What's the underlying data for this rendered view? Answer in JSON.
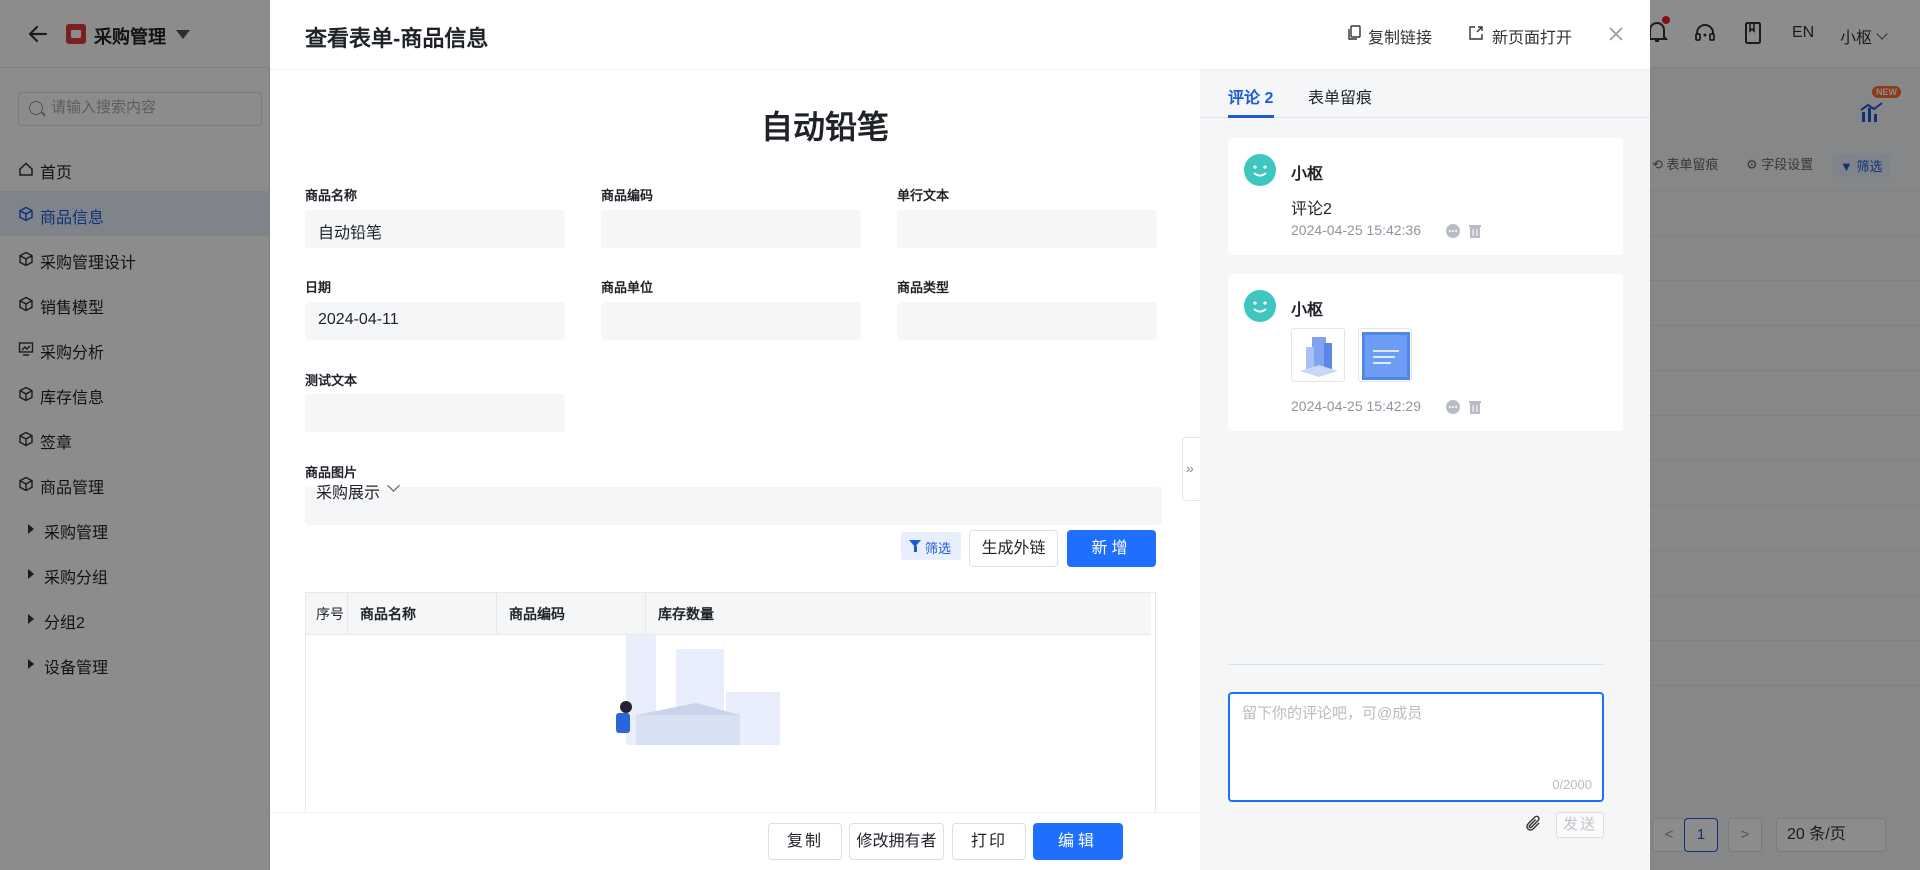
{
  "app": {
    "name": "采购管理",
    "lang": "EN",
    "user": "小枢",
    "search_placeholder": "请输入搜索内容"
  },
  "sidebar": {
    "items": [
      {
        "label": "首页",
        "icon": "home-icon"
      },
      {
        "label": "商品信息",
        "icon": "cube-icon",
        "active": true
      },
      {
        "label": "采购管理设计",
        "icon": "cube-icon"
      },
      {
        "label": "销售模型",
        "icon": "cube-icon"
      },
      {
        "label": "采购分析",
        "icon": "chart-icon"
      },
      {
        "label": "库存信息",
        "icon": "cube-icon"
      },
      {
        "label": "签章",
        "icon": "cube-icon"
      },
      {
        "label": "商品管理",
        "icon": "cube-icon"
      }
    ],
    "groups": [
      "采购管理",
      "采购分组",
      "分组2",
      "设备管理"
    ]
  },
  "background": {
    "toolbar": {
      "trace": "表单留痕",
      "field_settings": "字段设置",
      "filter": "筛选"
    },
    "new_badge": "NEW",
    "pager": {
      "current": "1",
      "page_size": "20 条/页",
      "prev": "<",
      "next": ">"
    }
  },
  "modal": {
    "title": "查看表单-商品信息",
    "copy_link": "复制链接",
    "open_new_page": "新页面打开",
    "form_title": "自动铅笔",
    "fields": {
      "name": {
        "label": "商品名称",
        "value": "自动铅笔"
      },
      "code": {
        "label": "商品编码",
        "value": ""
      },
      "single_text": {
        "label": "单行文本",
        "value": ""
      },
      "date": {
        "label": "日期",
        "value": "2024-04-11"
      },
      "unit": {
        "label": "商品单位",
        "value": ""
      },
      "type": {
        "label": "商品类型",
        "value": ""
      },
      "test_text": {
        "label": "测试文本",
        "value": ""
      },
      "image": {
        "label": "商品图片",
        "value": ""
      }
    },
    "section": {
      "title": "采购展示",
      "filter": "筛选",
      "gen_link": "生成外链",
      "add": "新增",
      "columns": [
        "序号",
        "商品名称",
        "商品编码",
        "库存数量"
      ]
    },
    "footer": {
      "copy": "复制",
      "change_owner": "修改拥有者",
      "print": "打印",
      "edit": "编辑"
    }
  },
  "comments": {
    "tabs": {
      "comments": "评论 2",
      "trace": "表单留痕"
    },
    "items": [
      {
        "author": "小枢",
        "text": "评论2",
        "time": "2024-04-25 15:42:36"
      },
      {
        "author": "小枢",
        "text": "",
        "time": "2024-04-25 15:42:29"
      }
    ],
    "input_placeholder": "留下你的评论吧，可@成员",
    "char_count": "0/2000",
    "send": "发送"
  }
}
